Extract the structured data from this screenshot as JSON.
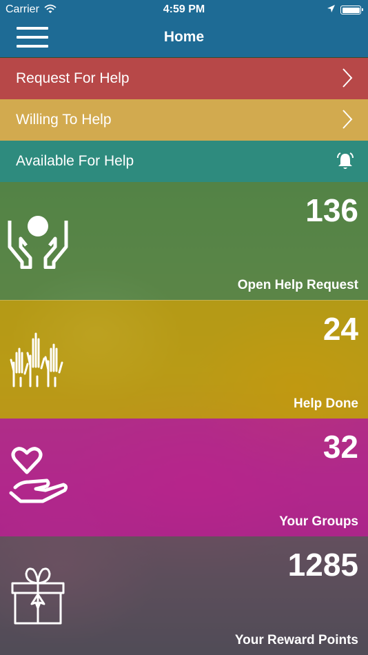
{
  "status_bar": {
    "carrier": "Carrier",
    "time": "4:59 PM",
    "wifi_icon": "wifi-icon",
    "location_icon": "location-arrow-icon",
    "battery_icon": "battery-full-icon"
  },
  "nav": {
    "title": "Home",
    "menu_icon": "hamburger-menu-icon",
    "color": "#1e6b95"
  },
  "menu_rows": [
    {
      "label": "Request For Help",
      "icon": "chevron-right-icon",
      "color": "#b74848"
    },
    {
      "label": "Willing To Help",
      "icon": "chevron-right-icon",
      "color": "#d2aa4f"
    },
    {
      "label": "Available For Help",
      "icon": "bell-ringing-icon",
      "color": "#2e8b7e"
    }
  ],
  "tiles": [
    {
      "value": "136",
      "caption": "Open Help Request",
      "icon": "hands-holding-icon",
      "color": "#48823c"
    },
    {
      "value": "24",
      "caption": "Help Done",
      "icon": "raised-hands-icon",
      "color": "#b99b00"
    },
    {
      "value": "32",
      "caption": "Your Groups",
      "icon": "heart-in-hand-icon",
      "color": "#aa148c"
    },
    {
      "value": "1285",
      "caption": "Your Reward Points",
      "icon": "gift-box-icon",
      "color": "#464650"
    }
  ]
}
